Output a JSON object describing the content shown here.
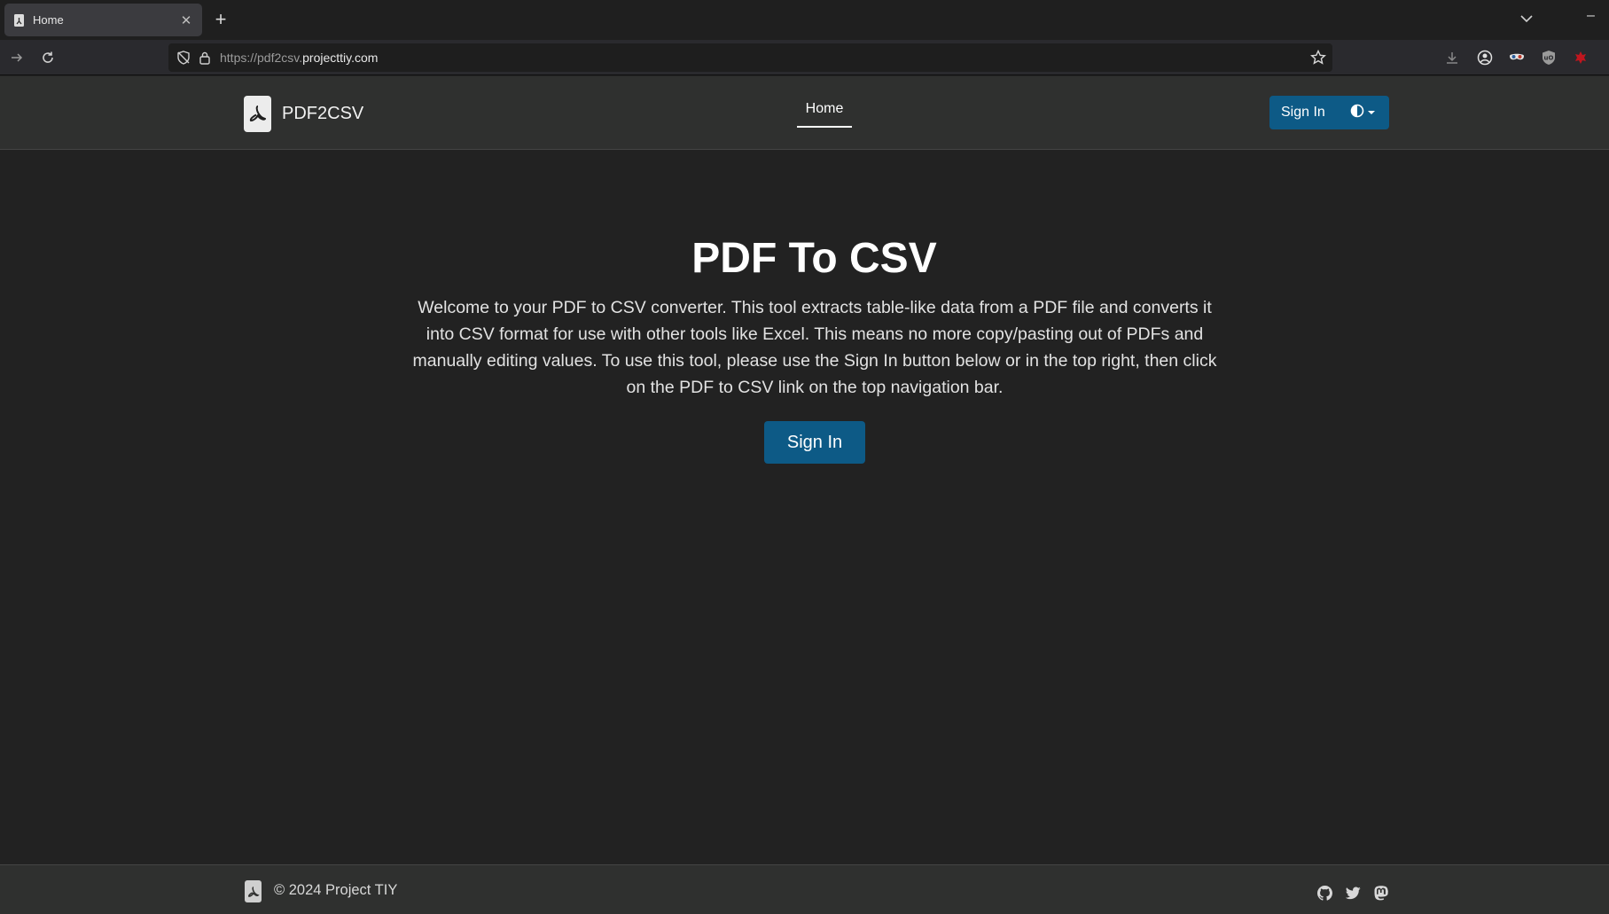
{
  "browser": {
    "tab_title": "Home",
    "url_prefix": "https://pdf2csv.",
    "url_domain": "projecttiy.com",
    "icons": [
      "pdf-favicon",
      "close-icon",
      "plus-icon",
      "chevron-down-icon",
      "minimize-icon",
      "forward-icon",
      "reload-icon",
      "tracking-shield-icon",
      "lock-icon",
      "star-icon",
      "download-icon",
      "account-icon",
      "extension-mask-icon",
      "extension-shield-icon",
      "extension-red-icon"
    ]
  },
  "header": {
    "brand_name": "PDF2CSV",
    "nav_home": "Home",
    "signin_label": "Sign In",
    "theme_icon": "contrast-icon"
  },
  "hero": {
    "title": "PDF To CSV",
    "description": "Welcome to your PDF to CSV converter. This tool extracts table-like data from a PDF file and converts it into CSV format for use with other tools like Excel. This means no more copy/pasting out of PDFs and manually editing values. To use this tool, please use the Sign In button below or in the top right, then click on the PDF to CSV link on the top navigation bar.",
    "signin_label": "Sign In"
  },
  "footer": {
    "copyright": "© 2024 Project TIY",
    "social_icons": [
      "github-icon",
      "twitter-icon",
      "mastodon-icon"
    ]
  },
  "colors": {
    "page_bg": "#222222",
    "header_bg": "#2f302f",
    "accent": "#0d5a86"
  }
}
